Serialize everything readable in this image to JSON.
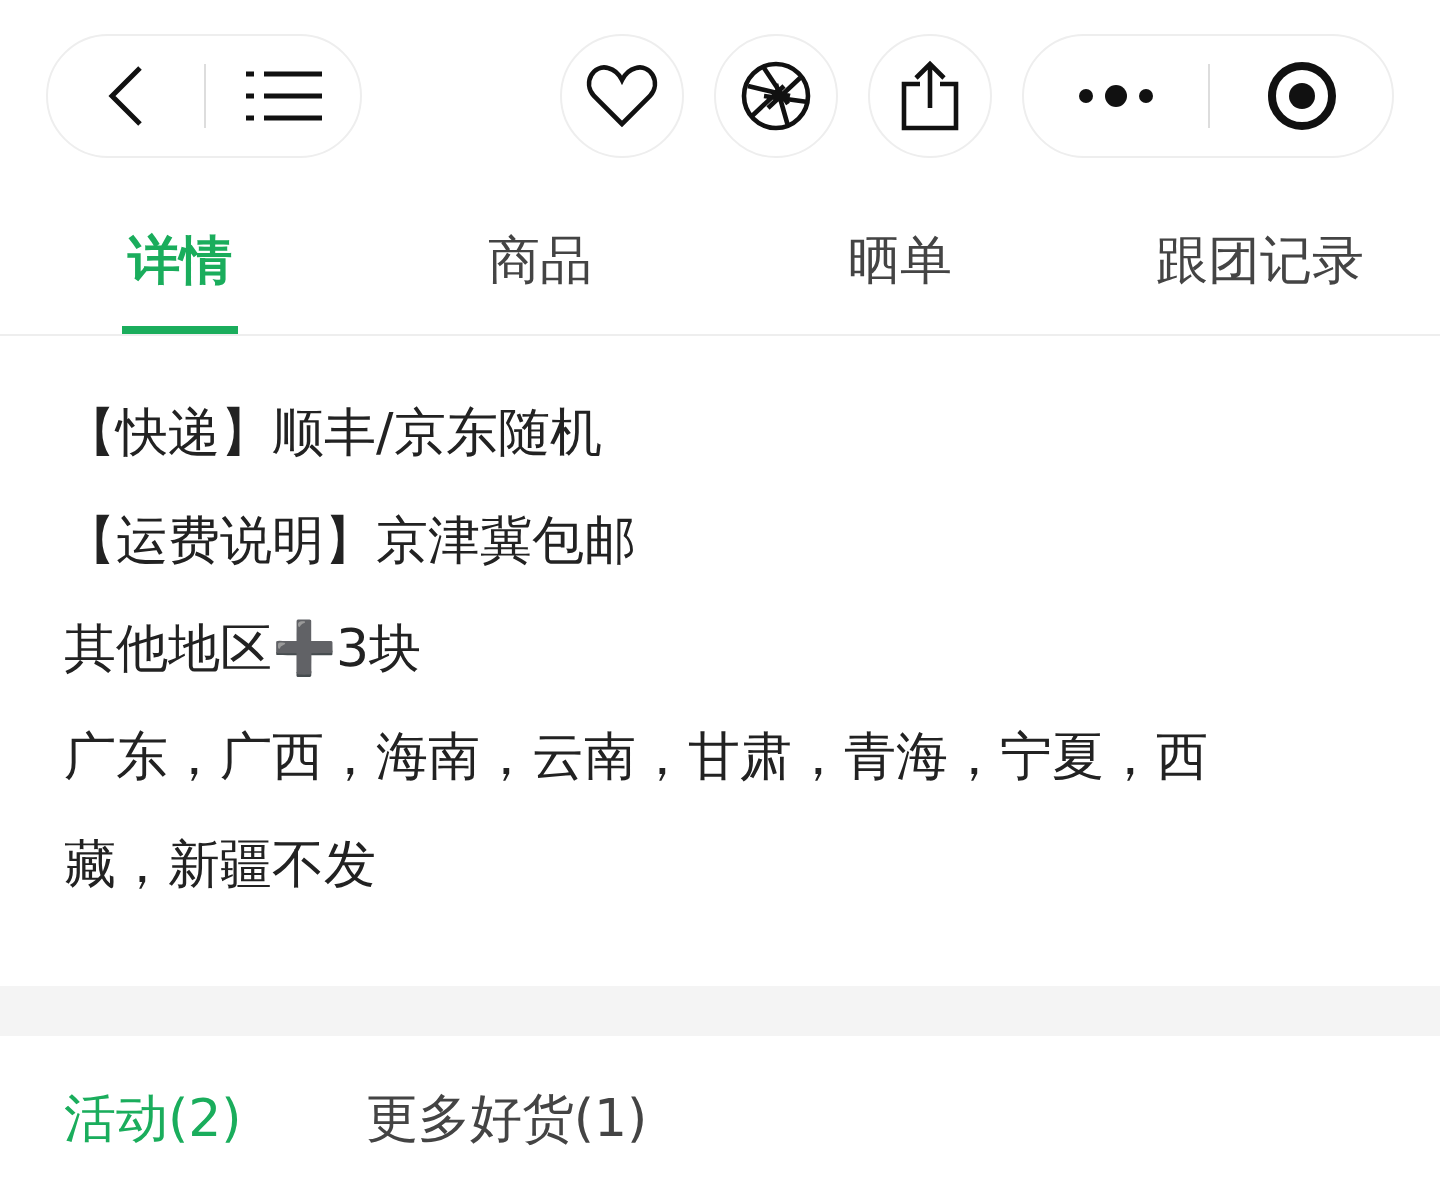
{
  "tabs": [
    {
      "label": "详情",
      "selected": true
    },
    {
      "label": "商品",
      "selected": false
    },
    {
      "label": "晒单",
      "selected": false
    },
    {
      "label": "跟团记录",
      "selected": false
    }
  ],
  "details": [
    "【快递】顺丰/京东随机",
    "【运费说明】京津冀包邮",
    "其他地区➕3块",
    "广东，广西，海南，云南，甘肃，青海，宁夏，西藏，新疆不发"
  ],
  "bottom_tabs": [
    {
      "label": "活动(2)",
      "selected": true
    },
    {
      "label": "更多好货(1)",
      "selected": false
    }
  ]
}
